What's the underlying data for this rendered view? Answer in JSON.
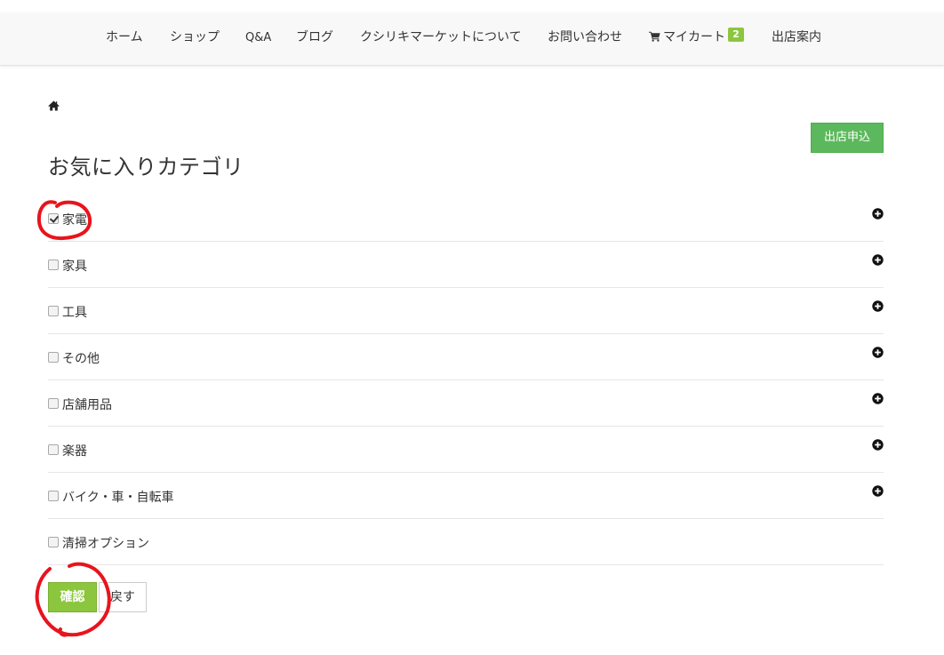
{
  "nav": {
    "items": [
      {
        "label": "ホーム"
      },
      {
        "label": "ショップ"
      },
      {
        "label": "Q&A"
      },
      {
        "label": "ブログ"
      },
      {
        "label": "クシリキマーケットについて"
      },
      {
        "label": "お問い合わせ"
      },
      {
        "label": "マイカート",
        "icon": "cart-icon"
      },
      {
        "label": "出店案内"
      }
    ],
    "cart_count": "2",
    "badge_color": "#8cc63f"
  },
  "breadcrumb": {
    "icon": "home-icon"
  },
  "apply_button": {
    "label": "出店申込",
    "color": "#5cb85c"
  },
  "page": {
    "title": "お気に入りカテゴリ"
  },
  "categories": [
    {
      "label": "家電",
      "checked": true,
      "expandable": true
    },
    {
      "label": "家具",
      "checked": false,
      "expandable": true
    },
    {
      "label": "工具",
      "checked": false,
      "expandable": true
    },
    {
      "label": "その他",
      "checked": false,
      "expandable": true
    },
    {
      "label": "店舗用品",
      "checked": false,
      "expandable": true
    },
    {
      "label": "楽器",
      "checked": false,
      "expandable": true
    },
    {
      "label": "バイク・車・自転車",
      "checked": false,
      "expandable": true
    },
    {
      "label": "清掃オプション",
      "checked": false,
      "expandable": false
    }
  ],
  "actions": {
    "confirm_label": "確認",
    "back_label": "戻す",
    "confirm_color": "#8cc63f"
  },
  "annotation_color": "#e8141c"
}
